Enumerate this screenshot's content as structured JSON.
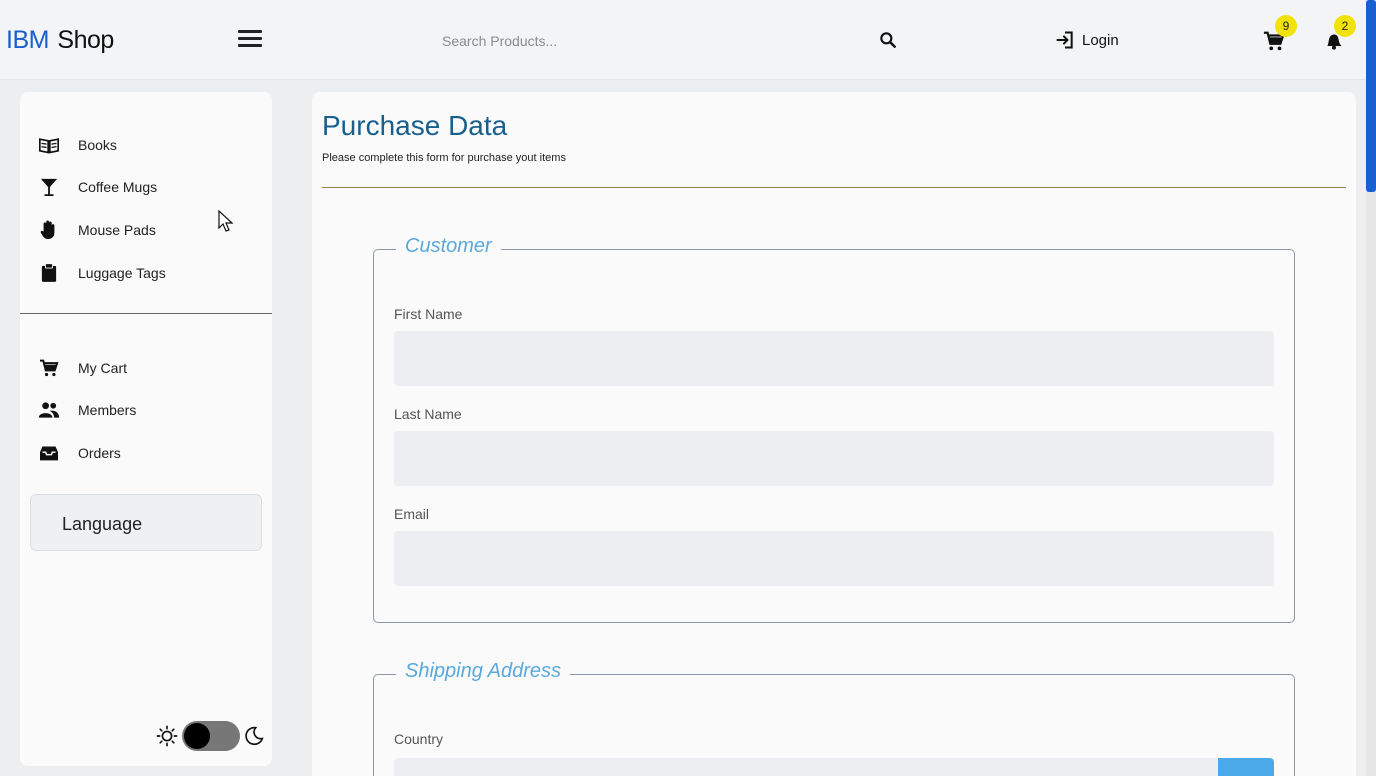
{
  "header": {
    "brand_primary": "IBM",
    "brand_secondary": "Shop",
    "search_placeholder": "Search Products...",
    "login_label": "Login",
    "cart_count": "9",
    "notification_count": "2"
  },
  "sidebar": {
    "categories": [
      {
        "label": "Books",
        "icon": "book-icon"
      },
      {
        "label": "Coffee Mugs",
        "icon": "cocktail-icon"
      },
      {
        "label": "Mouse Pads",
        "icon": "hand-icon"
      },
      {
        "label": "Luggage Tags",
        "icon": "clipboard-icon"
      }
    ],
    "links": [
      {
        "label": "My Cart",
        "icon": "cart-icon"
      },
      {
        "label": "Members",
        "icon": "users-icon"
      },
      {
        "label": "Orders",
        "icon": "inbox-icon"
      }
    ],
    "language_label": "Language"
  },
  "main": {
    "title": "Purchase Data",
    "subtitle": "Please complete this form for purchase yout items",
    "customer": {
      "legend": "Customer",
      "first_name_label": "First Name",
      "last_name_label": "Last Name",
      "email_label": "Email"
    },
    "shipping": {
      "legend": "Shipping Address",
      "country_label": "Country"
    }
  },
  "colors": {
    "brand": "#1a5fd0",
    "title": "#175f8f",
    "legend": "#5aa9dc",
    "badge": "#f1e20a"
  }
}
